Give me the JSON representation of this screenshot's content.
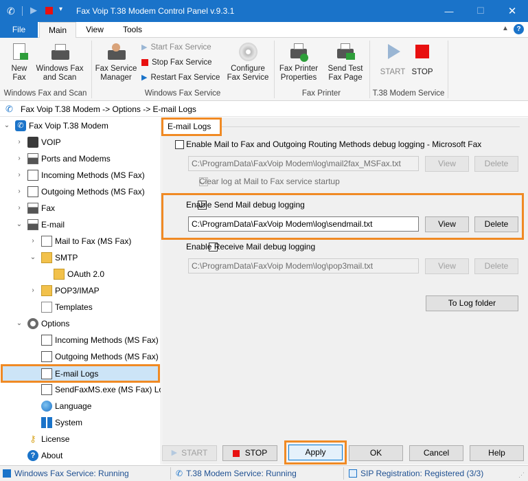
{
  "window": {
    "title": "Fax Voip T.38 Modem Control Panel v.9.3.1",
    "minimize_icon": "minimize-icon",
    "maximize_icon": "maximize-icon",
    "close_icon": "close-icon"
  },
  "ribbon_tabs": [
    "File",
    "Main",
    "View",
    "Tools"
  ],
  "ribbon": {
    "new_fax": [
      "New",
      "Fax"
    ],
    "windows_fax_scan": [
      "Windows Fax",
      "and Scan"
    ],
    "group1": "Windows Fax and Scan",
    "fax_service_manager": [
      "Fax Service",
      "Manager"
    ],
    "start_fax_service": "Start Fax Service",
    "stop_fax_service": "Stop Fax Service",
    "restart_fax_service": "Restart Fax Service",
    "configure_fax_service": [
      "Configure",
      "Fax Service"
    ],
    "group2": "Windows Fax Service",
    "fax_printer_properties": [
      "Fax Printer",
      "Properties"
    ],
    "send_test_fax_page": [
      "Send Test",
      "Fax Page"
    ],
    "group3": "Fax Printer",
    "start": "START",
    "stop": "STOP",
    "group4": "T.38 Modem Service"
  },
  "breadcrumb": "Fax Voip T.38 Modem -> Options -> E-mail Logs",
  "tree": {
    "root": "Fax Voip T.38 Modem",
    "voip": "VOIP",
    "ports_modems": "Ports and Modems",
    "incoming_methods": "Incoming Methods (MS Fax)",
    "outgoing_methods": "Outgoing Methods (MS Fax)",
    "fax": "Fax",
    "email": "E-mail",
    "mail_to_fax": "Mail to Fax (MS Fax)",
    "smtp": "SMTP",
    "oauth": "OAuth 2.0",
    "pop3_imap": "POP3/IMAP",
    "templates": "Templates",
    "options": "Options",
    "opt_incoming": "Incoming Methods (MS Fax)",
    "opt_outgoing": "Outgoing Methods (MS Fax)",
    "email_logs": "E-mail Logs",
    "sendfaxms": "SendFaxMS.exe (MS Fax) Lo",
    "language": "Language",
    "system": "System",
    "license": "License",
    "about": "About"
  },
  "panel": {
    "title": "E-mail Logs",
    "mail2fax": {
      "label": "Enable Mail to Fax and Outgoing Routing Methods debug logging - Microsoft Fax",
      "checked": false,
      "path": "C:\\ProgramData\\FaxVoip Modem\\log\\mail2fax_MSFax.txt",
      "clear_label": "Clear log at Mail to Fax service startup",
      "clear_checked": true
    },
    "sendmail": {
      "label": "Enable Send Mail debug logging",
      "checked": true,
      "path": "C:\\ProgramData\\FaxVoip Modem\\log\\sendmail.txt"
    },
    "receivemail": {
      "label": "Enable Receive Mail debug logging",
      "checked": false,
      "path": "C:\\ProgramData\\FaxVoip Modem\\log\\pop3mail.txt"
    },
    "view": "View",
    "delete": "Delete",
    "to_log_folder": "To Log folder"
  },
  "buttons": {
    "start": "START",
    "stop": "STOP",
    "apply": "Apply",
    "ok": "OK",
    "cancel": "Cancel",
    "help": "Help"
  },
  "status": {
    "fax_service": "Windows Fax Service: Running",
    "modem_service": "T.38 Modem Service: Running",
    "sip": "SIP Registration: Registered (3/3)"
  },
  "colors": {
    "accent": "#1a73c9",
    "highlight": "#f08a24",
    "stop_red": "#e81010"
  }
}
